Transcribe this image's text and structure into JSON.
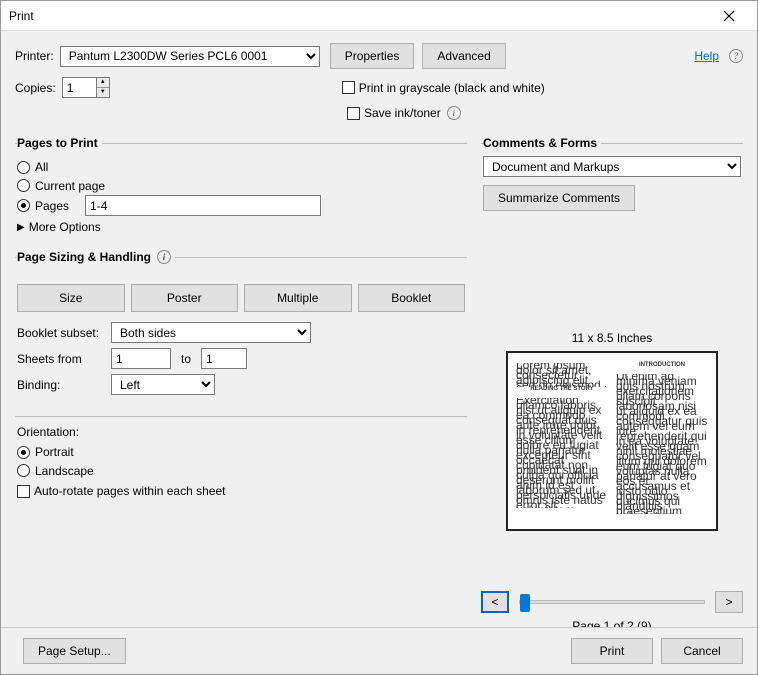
{
  "title": "Print",
  "top": {
    "printer_label": "Printer:",
    "printer_value": "Pantum L2300DW Series PCL6 0001",
    "properties_btn": "Properties",
    "advanced_btn": "Advanced",
    "help_link": "Help",
    "copies_label": "Copies:",
    "copies_value": "1",
    "grayscale_label": "Print in grayscale (black and white)",
    "saveink_label": "Save ink/toner"
  },
  "pages": {
    "heading": "Pages to Print",
    "all": "All",
    "current": "Current page",
    "pages_label": "Pages",
    "pages_value": "1-4",
    "more_options": "More Options"
  },
  "sizing": {
    "heading": "Page Sizing & Handling",
    "size": "Size",
    "poster": "Poster",
    "multiple": "Multiple",
    "booklet": "Booklet",
    "subset_label": "Booklet subset:",
    "subset_value": "Both sides",
    "sheets_from_label": "Sheets from",
    "sheets_from": "1",
    "to_label": "to",
    "sheets_to": "1",
    "binding_label": "Binding:",
    "binding_value": "Left"
  },
  "orientation": {
    "heading": "Orientation:",
    "portrait": "Portrait",
    "landscape": "Landscape",
    "autorotate": "Auto-rotate pages within each sheet"
  },
  "comments": {
    "heading": "Comments & Forms",
    "selected": "Document and Markups",
    "summarize_btn": "Summarize Comments"
  },
  "preview": {
    "dimensions": "11 x 8.5 Inches",
    "left_heading": "READING THE STORY",
    "right_heading": "INTRODUCTION",
    "page_info": "Page 1 of 2 (9)",
    "prev": "<",
    "next": ">"
  },
  "footer": {
    "page_setup": "Page Setup...",
    "print": "Print",
    "cancel": "Cancel"
  }
}
